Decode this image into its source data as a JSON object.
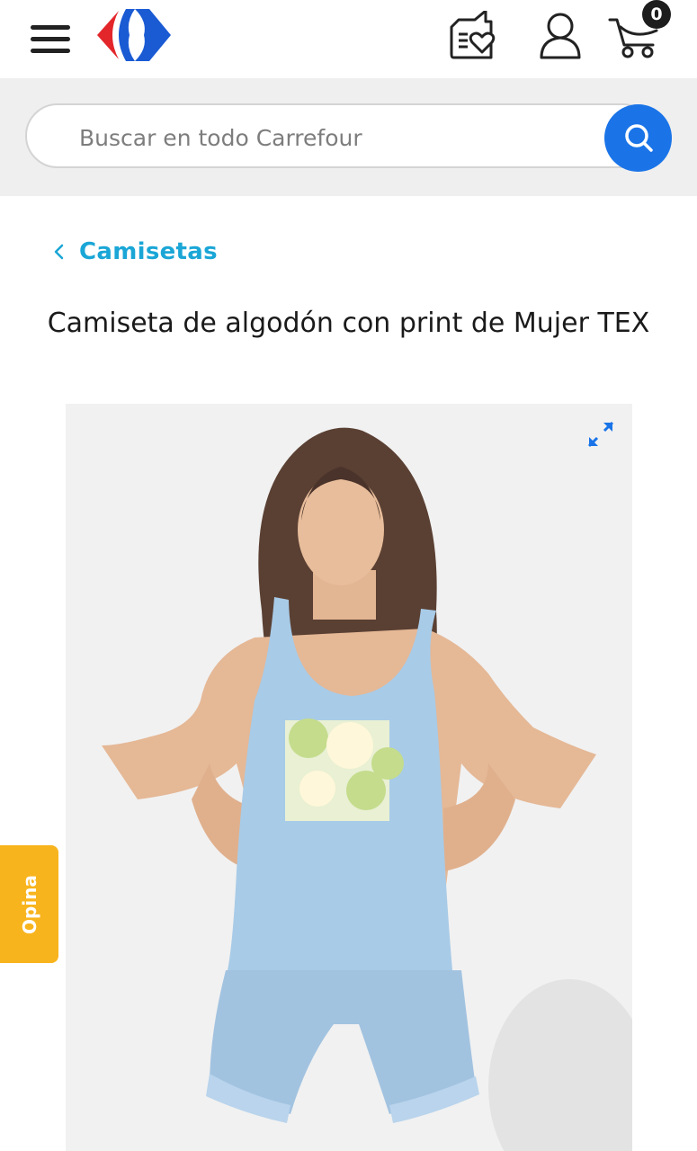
{
  "header": {
    "menu_icon": "hamburger-menu-icon",
    "logo_icon": "carrefour-logo-icon",
    "list_icon": "shopping-list-heart-icon",
    "user_icon": "user-account-icon",
    "cart_icon": "shopping-cart-icon",
    "cart_count": "0"
  },
  "search": {
    "placeholder": "Buscar en todo Carrefour",
    "button_icon": "search-icon"
  },
  "breadcrumb": {
    "icon": "chevron-left-icon",
    "label": "Camisetas"
  },
  "product": {
    "title": "Camiseta de algodón con print de Mujer TEX",
    "image_icon": "expand-icon"
  },
  "feedback": {
    "label": "Opina"
  },
  "colors": {
    "brand_blue": "#1a74e8",
    "brand_red": "#e3262a",
    "breadcrumb_cyan": "#1aa6d6",
    "feedback_yellow": "#f8b41d",
    "search_band": "#efefef"
  }
}
